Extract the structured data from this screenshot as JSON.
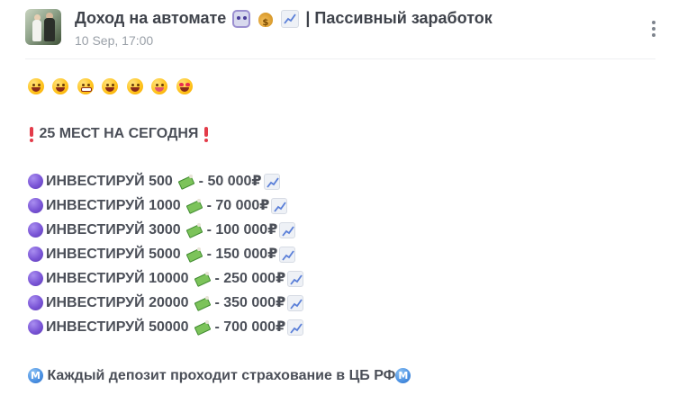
{
  "post": {
    "title": "Доход на автомате",
    "title_suffix": "| Пассивный заработок",
    "date": "10 Sep, 17:00",
    "title_icons": [
      "robot-icon",
      "money-bag-icon",
      "chart-increasing-icon"
    ]
  },
  "content": {
    "emoji_row": [
      "grinning-face-icon",
      "smiling-face-icon",
      "grimacing-face-icon",
      "star-struck-face-icon",
      "laughing-face-icon",
      "yum-face-icon",
      "heart-eyes-face-icon"
    ],
    "headline": "25 МЕСТ НА СЕГОДНЯ",
    "offers": [
      {
        "text": "ИНВЕСТИРУЙ 500",
        "result": "- 50 000₽"
      },
      {
        "text": "ИНВЕСТИРУЙ 1000",
        "result": "- 70 000₽"
      },
      {
        "text": "ИНВЕСТИРУЙ 3000",
        "result": "- 100 000₽"
      },
      {
        "text": "ИНВЕСТИРУЙ 5000",
        "result": "- 150 000₽"
      },
      {
        "text": "ИНВЕСТИРУЙ 10000",
        "result": "- 250 000₽"
      },
      {
        "text": "ИНВЕСТИРУЙ 20000",
        "result": "- 350 000₽"
      },
      {
        "text": "ИНВЕСТИРУЙ 50000",
        "result": "- 700 000₽"
      }
    ],
    "footer": "Каждый депозит проходит страхование в ЦБ РФ",
    "footer_icon_letter": "M"
  },
  "colors": {
    "text": "#4b4f58",
    "date": "#9aa0a8",
    "accent_purple": "#7a55d6",
    "exclaim_red": "#e33c4a",
    "metro_blue": "#4a90e2"
  }
}
